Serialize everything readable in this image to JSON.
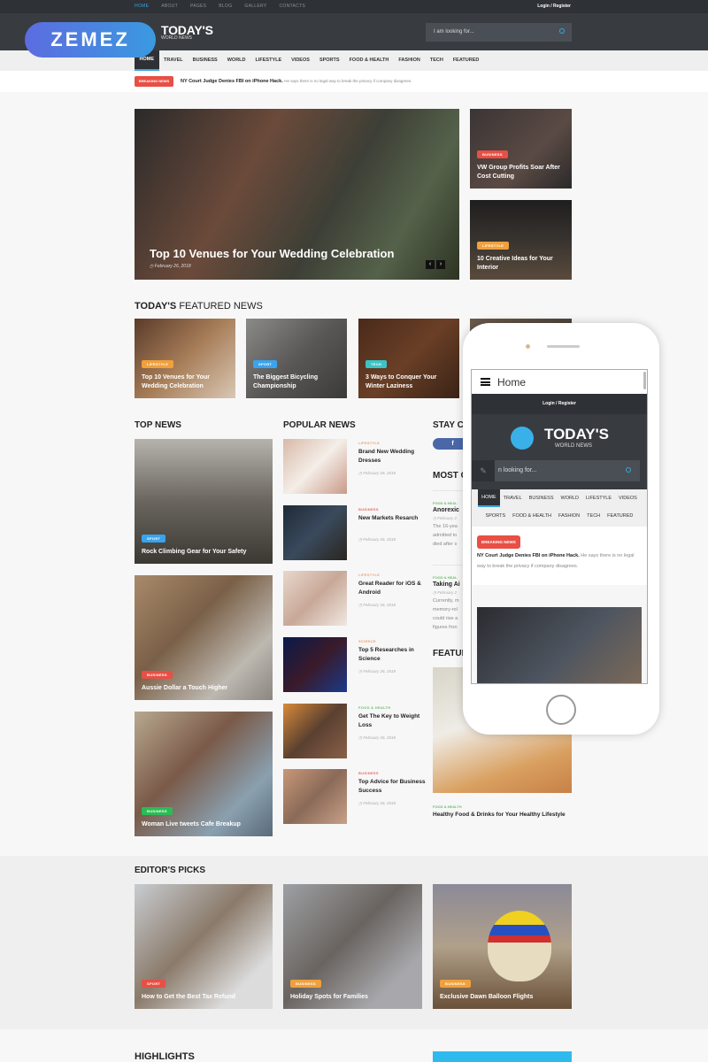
{
  "topbar": {
    "links": [
      "HOME",
      "ABOUT",
      "PAGES",
      "BLOG",
      "GALLERY",
      "CONTACTS"
    ],
    "login": "Login / Register"
  },
  "brand": {
    "watermark": "ZEMEZ",
    "title": "TODAY'S",
    "subtitle": "WORLD NEWS"
  },
  "search": {
    "placeholder": "I am looking for..."
  },
  "nav": [
    "HOME",
    "TRAVEL",
    "BUSINESS",
    "WORLD",
    "LIFESTYLE",
    "VIDEOS",
    "SPORTS",
    "FOOD & HEALTH",
    "FASHION",
    "TECH",
    "FEATURED"
  ],
  "breaking": {
    "badge": "BREAKING NEWS",
    "headline": "NY Court Judge Denies FBI on iPhone Hack.",
    "summary": "He says there is no legal way to break the privacy if company disagrees."
  },
  "hero": {
    "title": "Top 10 Venues for Your Wedding Celebration",
    "date": "February 26, 2018",
    "prev": "‹",
    "next": "›"
  },
  "side_stories": [
    {
      "tag": "BUSINESS",
      "tag_color": "#e84f45",
      "title": "VW Group Profits Soar After Cost Cutting"
    },
    {
      "tag": "LIFESTYLE",
      "tag_color": "#f0a03c",
      "title": "10 Creative Ideas for Your Interior"
    }
  ],
  "featured": {
    "title_bold": "TODAY'S",
    "title_rest": "FEATURED NEWS",
    "items": [
      {
        "tag": "LIFESTYLE",
        "tag_color": "#f0a03c",
        "title": "Top 10 Venues for Your Wedding Celebration"
      },
      {
        "tag": "SPORT",
        "tag_color": "#3aa3ee",
        "title": "The Biggest Bicycling Championship"
      },
      {
        "tag": "TECH",
        "tag_color": "#3cc4c4",
        "title": "3 Ways to Conquer Your Winter Laziness"
      }
    ]
  },
  "top_news": {
    "title": "TOP NEWS",
    "items": [
      {
        "tag": "SPORT",
        "tag_color": "#3aa3ee",
        "title": "Rock Climbing Gear for Your Safety"
      },
      {
        "tag": "BUSINESS",
        "tag_color": "#e84f45",
        "title": "Aussie Dollar a Touch Higher"
      },
      {
        "tag": "BUSINESS",
        "tag_color": "#2dbb55",
        "title": "Woman Live tweets Cafe Breakup"
      }
    ]
  },
  "popular_news": {
    "title": "POPULAR NEWS",
    "items": [
      {
        "cat": "LIFESTYLE",
        "cat_color": "#f0a070",
        "title": "Brand New Wedding Dresses",
        "date": "February 26, 2018"
      },
      {
        "cat": "BUSINESS",
        "cat_color": "#e86a6a",
        "title": "New Markets Resarch",
        "date": "February 26, 2018"
      },
      {
        "cat": "LIFESTYLE",
        "cat_color": "#f0a070",
        "title": "Great Reader for iOS & Android",
        "date": "February 26, 2018"
      },
      {
        "cat": "SCIENCE",
        "cat_color": "#f0a070",
        "title": "Top 5 Researches in Science",
        "date": "February 26, 2018"
      },
      {
        "cat": "FOOD & HEALTH",
        "cat_color": "#6bbf6b",
        "title": "Get The Key to Weight Loss",
        "date": "February 26, 2018"
      },
      {
        "cat": "BUSINESS",
        "cat_color": "#e86a6a",
        "title": "Top Advice for Business Success",
        "date": "February 26, 2018"
      }
    ]
  },
  "right_col": {
    "stay_title": "STAY CO",
    "fb": "f",
    "most_title": "MOST C",
    "most": [
      {
        "cat": "FOOD & HEAL",
        "title": "Anorexic",
        "date": "February 2",
        "excerpt": [
          "The 16-yea",
          "admitted to",
          "died after s"
        ]
      },
      {
        "cat": "FOOD & HEAL",
        "title": "Taking Ai",
        "date": "February 2",
        "excerpt": [
          "Currently, m",
          "memory-rol",
          "could rise a",
          "figures fron"
        ]
      }
    ],
    "feat_title": "FEATUR",
    "feat_item": {
      "cat": "FOOD & HEALTH",
      "title": "Healthy Food & Drinks for Your Healthy Lifestyle"
    }
  },
  "editors": {
    "title": "EDITOR'S PICKS",
    "items": [
      {
        "tag": "SPORT",
        "tag_color": "#e84f45",
        "title": "How to Get the Best Tax Refund"
      },
      {
        "tag": "BUSINESS",
        "tag_color": "#f0a03c",
        "title": "Holiday Spots for Families"
      },
      {
        "tag": "BUSINESS",
        "tag_color": "#f0a03c",
        "title": "Exclusive Dawn Balloon Flights"
      }
    ]
  },
  "highlights": {
    "title": "HIGHLIGHTS"
  },
  "phone": {
    "menu_label": "Home",
    "login": "Login / Register",
    "title": "TODAY'S",
    "subtitle": "WORLD NEWS",
    "search_placeholder": "n looking for...",
    "nav": [
      "HOME",
      "TRAVEL",
      "BUSINESS",
      "WORLD",
      "LIFESTYLE",
      "VIDEOS",
      "SPORTS",
      "FOOD & HEALTH",
      "FASHION",
      "TECH",
      "FEATURED"
    ],
    "badge": "BREAKING NEWS",
    "headline": "NY Court Judge Denies FBI on iPhone Hack.",
    "summary": "He says there is no legal way to break the privacy if company disagrees."
  }
}
